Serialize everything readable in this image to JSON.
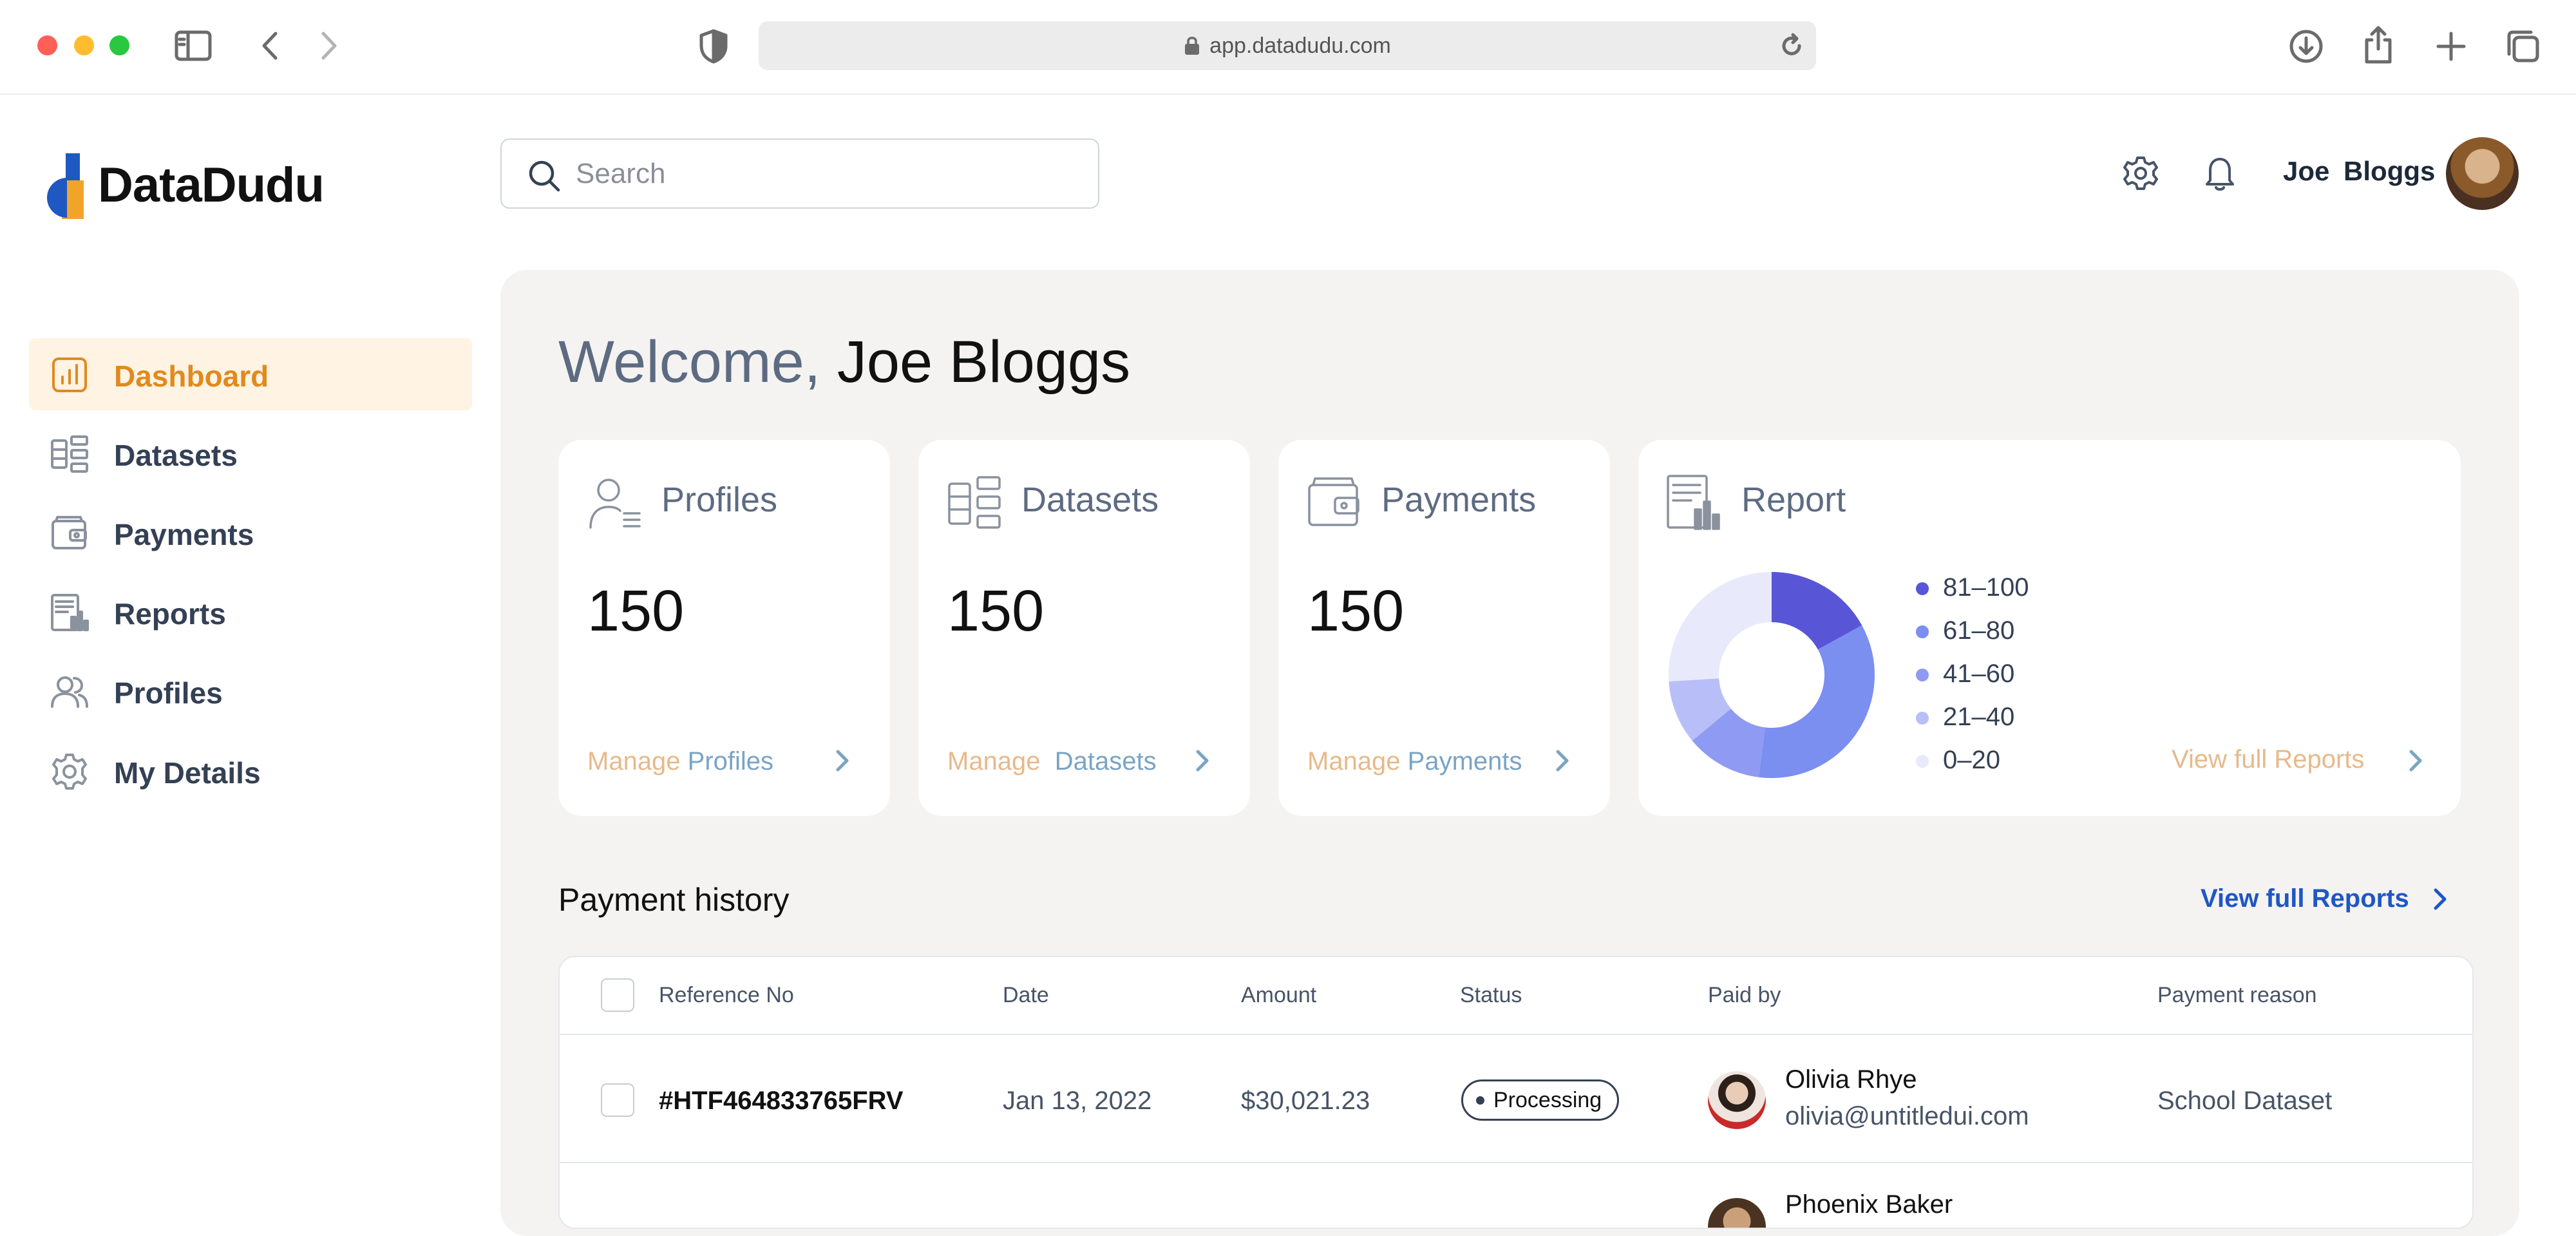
{
  "browser": {
    "url": "app.datadudu.com",
    "traffic_lights": [
      "#ff5f57",
      "#febc2e",
      "#28c840"
    ]
  },
  "app": {
    "name": "DataDudu",
    "search_placeholder": "Search",
    "user_name": "Joe  Bloggs"
  },
  "sidebar": {
    "items": [
      {
        "label": "Dashboard",
        "icon": "dashboard-icon",
        "active": true
      },
      {
        "label": "Datasets",
        "icon": "datasets-icon",
        "active": false
      },
      {
        "label": "Payments",
        "icon": "wallet-icon",
        "active": false
      },
      {
        "label": "Reports",
        "icon": "report-icon",
        "active": false
      },
      {
        "label": "Profiles",
        "icon": "users-icon",
        "active": false
      },
      {
        "label": "My Details",
        "icon": "gear-icon",
        "active": false
      }
    ],
    "active_color": "#e08a1e"
  },
  "main": {
    "welcome_greeting": "Welcome, ",
    "welcome_name": "Joe Bloggs",
    "cards": [
      {
        "title": "Profiles",
        "value": "150",
        "link_a": "Manage ",
        "link_b": "Profiles"
      },
      {
        "title": "Datasets",
        "value": "150",
        "link_a": "Manage  ",
        "link_b": "Datasets"
      },
      {
        "title": "Payments",
        "value": "150",
        "link_a": "Manage ",
        "link_b": "Payments"
      }
    ],
    "report": {
      "title": "Report",
      "link": "View full Reports",
      "legend": [
        {
          "label": "81–100",
          "color": "#5856d6"
        },
        {
          "label": "61–80",
          "color": "#7b8ff0"
        },
        {
          "label": "41–60",
          "color": "#8f9af2"
        },
        {
          "label": "21–40",
          "color": "#b8bff8"
        },
        {
          "label": "0–20",
          "color": "#e8eafc"
        }
      ],
      "slices": [
        17,
        35,
        12,
        10,
        26
      ]
    },
    "payment_history": {
      "title": "Payment history",
      "view_link": "View full Reports",
      "columns": [
        "Reference No",
        "Date",
        "Amount",
        "Status",
        "Paid by",
        "Payment reason"
      ],
      "rows": [
        {
          "ref": "#HTF464833765FRV",
          "date": "Jan 13, 2022",
          "amount": "$30,021.23",
          "status": "Processing",
          "payer_name": "Olivia Rhye",
          "payer_email": "olivia@untitledui.com",
          "reason": "School Dataset"
        },
        {
          "payer_name": "Phoenix Baker"
        }
      ]
    }
  }
}
